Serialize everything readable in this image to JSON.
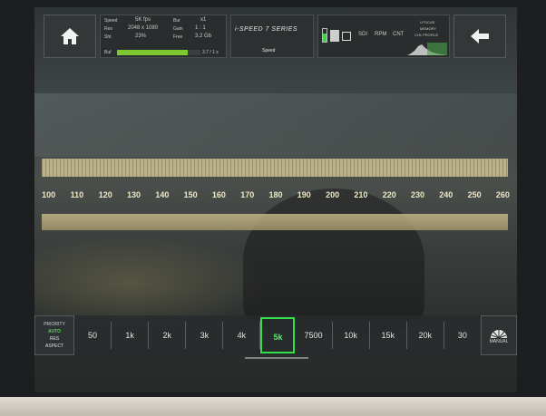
{
  "top": {
    "info": {
      "speed_label": "Speed",
      "speed_value": "5K fps",
      "res_label": "Res",
      "res_value": "2048 x 1080",
      "shutter_label": "Sht",
      "shutter_value": "23%",
      "burst_label": "Bur",
      "burst_value": "x1",
      "gain_label": "Gain",
      "gain_value": "1 : 1",
      "free_label": "Free",
      "free_value": "3.2 Gb",
      "buf_label": "Buf",
      "buf_progress": 0.85,
      "buf_readout": "3.7 / 1 s"
    },
    "brand": {
      "logo_text": "i-SPEED 7 SERIES",
      "mode_label": "Speed"
    },
    "status": {
      "col1": "SDI",
      "col2": "RPM",
      "col3": "CNT",
      "right_top": "i-FOCUS",
      "right_mid": "MEMORY",
      "right_bot": "CH1 PROFILE"
    }
  },
  "ruler": {
    "numbers": [
      "100",
      "110",
      "120",
      "130",
      "140",
      "150",
      "160",
      "170",
      "180",
      "190",
      "200",
      "210",
      "220",
      "230",
      "240",
      "250",
      "260"
    ]
  },
  "bottom": {
    "left_panel": {
      "title": "PRIORITY",
      "active": "AUTO",
      "option1": "RES",
      "option2": "ASPECT"
    },
    "wb_items": [
      "50",
      "1k",
      "2k",
      "3k",
      "4k",
      "5k",
      "7500",
      "10k",
      "15k",
      "20k",
      "30"
    ],
    "selected_index": 5,
    "right_label": "MANUAL"
  },
  "colors": {
    "accent_green": "#33e04a",
    "bar_green": "#7ec832"
  }
}
